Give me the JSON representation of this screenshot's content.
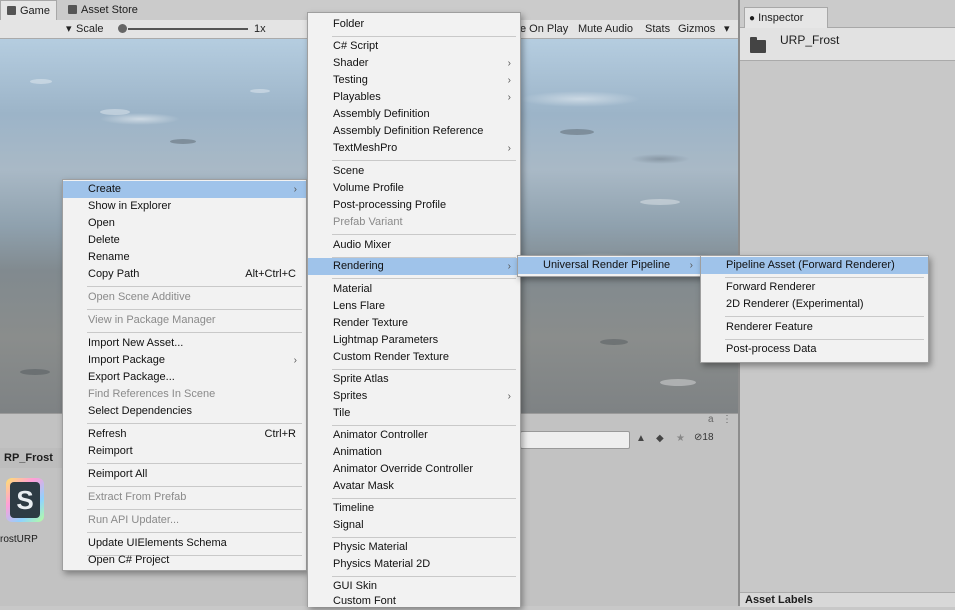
{
  "tabs": {
    "game": "Game",
    "asset_store": "Asset Store"
  },
  "toolbar": {
    "scale_label": "Scale",
    "scale_value": "1x",
    "maximize_on_play": "e On Play",
    "mute_audio": "Mute Audio",
    "stats": "Stats",
    "gizmos": "Gizmos"
  },
  "project": {
    "folder_title": "RP_Frost",
    "asset_label": "rostURP",
    "asset_icon_letter": "S",
    "count": "18",
    "lock": "a"
  },
  "inspector": {
    "tab": "Inspector",
    "title": "URP_Frost",
    "asset_labels": "Asset Labels"
  },
  "context_menu": {
    "items": [
      {
        "label": "Create",
        "arrow": "›"
      },
      {
        "label": "Show in Explorer"
      },
      {
        "label": "Open"
      },
      {
        "label": "Delete"
      },
      {
        "label": "Rename"
      },
      {
        "label": "Copy Path",
        "shortcut": "Alt+Ctrl+C"
      },
      {
        "label": "Open Scene Additive"
      },
      {
        "label": "View in Package Manager"
      },
      {
        "label": "Import New Asset..."
      },
      {
        "label": "Import Package",
        "arrow": "›"
      },
      {
        "label": "Export Package..."
      },
      {
        "label": "Find References In Scene"
      },
      {
        "label": "Select Dependencies"
      },
      {
        "label": "Refresh",
        "shortcut": "Ctrl+R"
      },
      {
        "label": "Reimport"
      },
      {
        "label": "Reimport All"
      },
      {
        "label": "Extract From Prefab"
      },
      {
        "label": "Run API Updater..."
      },
      {
        "label": "Update UIElements Schema"
      },
      {
        "label": "Open C# Project"
      }
    ]
  },
  "create_menu": {
    "items": [
      {
        "label": "Folder"
      },
      {
        "label": "C# Script"
      },
      {
        "label": "Shader",
        "arrow": "›"
      },
      {
        "label": "Testing",
        "arrow": "›"
      },
      {
        "label": "Playables",
        "arrow": "›"
      },
      {
        "label": "Assembly Definition"
      },
      {
        "label": "Assembly Definition Reference"
      },
      {
        "label": "TextMeshPro",
        "arrow": "›"
      },
      {
        "label": "Scene"
      },
      {
        "label": "Volume Profile"
      },
      {
        "label": "Post-processing Profile"
      },
      {
        "label": "Prefab Variant"
      },
      {
        "label": "Audio Mixer"
      },
      {
        "label": "Rendering",
        "arrow": "›"
      },
      {
        "label": "Material"
      },
      {
        "label": "Lens Flare"
      },
      {
        "label": "Render Texture"
      },
      {
        "label": "Lightmap Parameters"
      },
      {
        "label": "Custom Render Texture"
      },
      {
        "label": "Sprite Atlas"
      },
      {
        "label": "Sprites",
        "arrow": "›"
      },
      {
        "label": "Tile"
      },
      {
        "label": "Animator Controller"
      },
      {
        "label": "Animation"
      },
      {
        "label": "Animator Override Controller"
      },
      {
        "label": "Avatar Mask"
      },
      {
        "label": "Timeline"
      },
      {
        "label": "Signal"
      },
      {
        "label": "Physic Material"
      },
      {
        "label": "Physics Material 2D"
      },
      {
        "label": "GUI Skin"
      },
      {
        "label": "Custom Font"
      }
    ]
  },
  "rendering_menu": {
    "items": [
      {
        "label": "Universal Render Pipeline",
        "arrow": "›"
      }
    ]
  },
  "urp_menu": {
    "items": [
      {
        "label": "Pipeline Asset (Forward Renderer)"
      },
      {
        "label": "Forward Renderer"
      },
      {
        "label": "2D Renderer (Experimental)"
      },
      {
        "label": "Renderer Feature"
      },
      {
        "label": "Post-process Data"
      }
    ]
  },
  "colors": {
    "highlight": "#9fc3ea",
    "menu_bg": "#f2f2f2",
    "disabled_text": "#8a8a8a"
  }
}
